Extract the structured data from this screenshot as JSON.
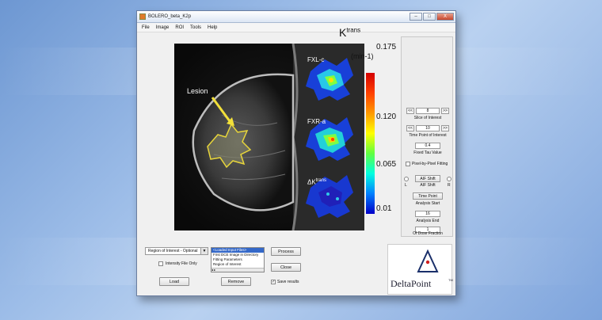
{
  "window": {
    "title": "BOLERO_beta_K2p",
    "buttons": {
      "minimize": "–",
      "maximize": "□",
      "close": "X"
    }
  },
  "menu": [
    "File",
    "Image",
    "ROI",
    "Tools",
    "Help"
  ],
  "figure": {
    "lesion_label": "Lesion",
    "panel_labels": [
      "FXL-c",
      "FXR-a",
      "ΔK"
    ],
    "panel_label_sup": "trans",
    "colorbar_title": "K",
    "colorbar_title_sup": "trans",
    "colorbar_units": "(min-1)",
    "colorbar_ticks": [
      "0.175",
      "0.120",
      "0.065",
      "0.01"
    ],
    "lesion_outline_color": "#e8d63a",
    "colormap": [
      "#d40000",
      "#ff9900",
      "#ffff00",
      "#60ff40",
      "#00ffe0",
      "#0080ff",
      "#0000c8"
    ]
  },
  "controls": {
    "slice_value": "8",
    "slice_label": "Slice of Interest",
    "time_value": "10",
    "time_label": "Time Point of Interest",
    "tau_value": "0.4",
    "tau_label": "Fixed Tau Value",
    "pixel_fitting_label": "Pixel-by-Pixel Fitting",
    "aif_button": "AIF Shift",
    "aif_label": "AIF Shift",
    "radio_left": "L",
    "radio_right": "R",
    "time_point_button": "Time Point",
    "analysis_start_label": "Analysis Start",
    "analysis_end_value": "16",
    "analysis_end_label": "Analysis End",
    "dose_value": "1",
    "dose_label": "Of Dose Fraction",
    "dec": "<<",
    "inc": ">>"
  },
  "bottom": {
    "roi_dropdown": "Region of Interest - Optional",
    "intensity_label": "Intensity File Only",
    "list_items": [
      "<Loaded Input Files>",
      "First DCE Image in Directory",
      "Fitting Parameters",
      "Region of Interest"
    ],
    "process_button": "Process",
    "close_button": "Close",
    "load_button": "Load",
    "remove_button": "Remove",
    "save_results_label": "Save results",
    "save_results_checked": true
  },
  "logo": {
    "name": "DeltaPoint",
    "tm": "TM"
  }
}
